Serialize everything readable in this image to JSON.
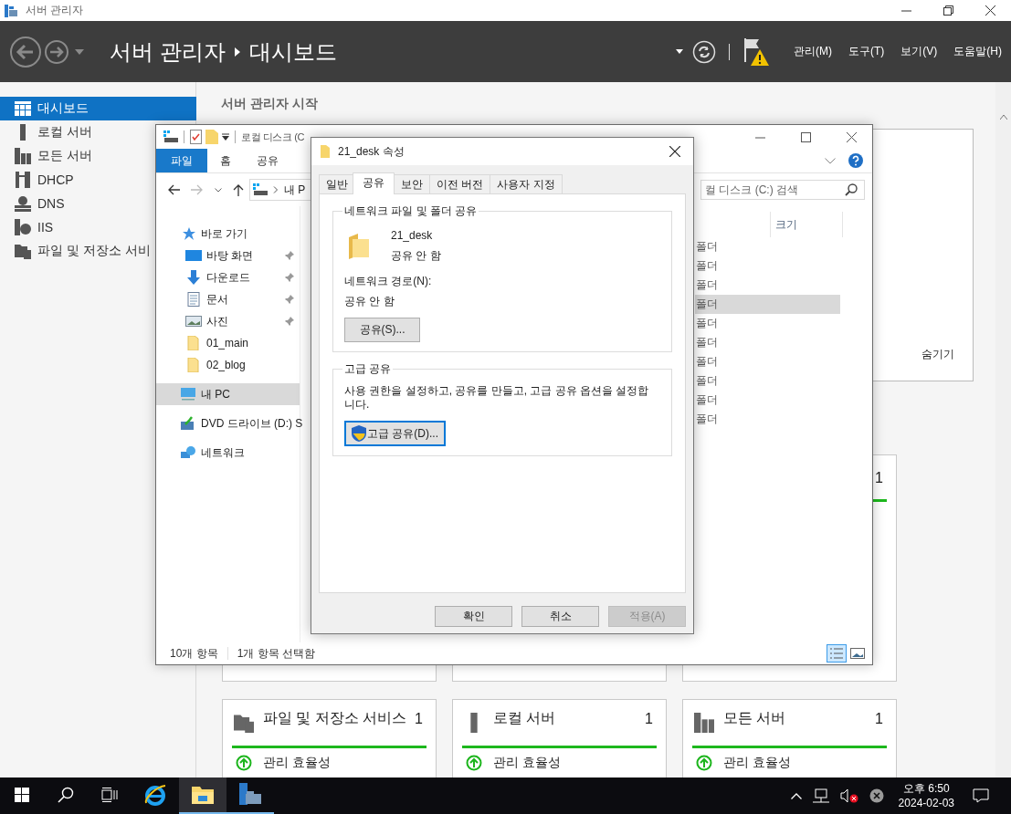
{
  "window": {
    "title": "서버 관리자"
  },
  "header": {
    "breadcrumb": [
      "서버 관리자",
      "대시보드"
    ],
    "menus": [
      "관리(M)",
      "도구(T)",
      "보기(V)",
      "도움말(H)"
    ]
  },
  "sidebar": {
    "items": [
      {
        "kind": "dashboard",
        "label": "대시보드",
        "selected": true
      },
      {
        "kind": "local",
        "label": "로컬 서버",
        "selected": false
      },
      {
        "kind": "all",
        "label": "모든 서버",
        "selected": false
      },
      {
        "kind": "dhcp",
        "label": "DHCP",
        "selected": false
      },
      {
        "kind": "dns",
        "label": "DNS",
        "selected": false
      },
      {
        "kind": "iis",
        "label": "IIS",
        "selected": false
      },
      {
        "kind": "files",
        "label": "파일 및 저장소 서비",
        "selected": false
      }
    ]
  },
  "dashboard": {
    "heading": "서버 관리자 시작",
    "hide": "숨기기",
    "top_row": {
      "count": "1"
    },
    "tiles": [
      {
        "kind": "files",
        "title": "파일 및 저장소 서비스",
        "count": "1",
        "status": "관리 효율성"
      },
      {
        "kind": "local",
        "title": "로컬 서버",
        "count": "1",
        "status": "관리 효율성"
      },
      {
        "kind": "all",
        "title": "모든 서버",
        "count": "1",
        "status": "관리 효율성"
      }
    ]
  },
  "explorer": {
    "title": "로컬 디스크 (C",
    "ribbon_tabs": [
      {
        "label": "파일",
        "selected": true
      },
      {
        "label": "홈",
        "selected": false
      },
      {
        "label": "공유",
        "selected": false
      }
    ],
    "address": "내 P",
    "search": {
      "placeholder": "컬 디스크 (C:) 검색"
    },
    "nav": [
      {
        "kind": "star",
        "label": "바로 가기",
        "selected": false,
        "children": [
          {
            "kind": "desktop",
            "label": "바탕 화면",
            "selected": false,
            "pinned": true
          },
          {
            "kind": "download",
            "label": "다운로드",
            "selected": false,
            "pinned": true
          },
          {
            "kind": "docs",
            "label": "문서",
            "selected": false,
            "pinned": true
          },
          {
            "kind": "pics",
            "label": "사진",
            "selected": false,
            "pinned": true
          },
          {
            "kind": "folder",
            "label": "01_main",
            "selected": false,
            "pinned": false
          },
          {
            "kind": "folder",
            "label": "02_blog",
            "selected": false,
            "pinned": false
          }
        ]
      },
      {
        "kind": "pc",
        "label": "내 PC",
        "selected": true
      },
      {
        "kind": "dvd",
        "label": "DVD 드라이브 (D:) S",
        "selected": false
      },
      {
        "kind": "network",
        "label": "네트워크",
        "selected": false
      }
    ],
    "columns": [
      "크기"
    ],
    "rows": [
      {
        "type": "폴더",
        "selected": false
      },
      {
        "type": "폴더",
        "selected": false
      },
      {
        "type": "폴더",
        "selected": false
      },
      {
        "type": "폴더",
        "selected": true
      },
      {
        "type": "폴더",
        "selected": false
      },
      {
        "type": "폴더",
        "selected": false
      },
      {
        "type": "폴더",
        "selected": false
      },
      {
        "type": "폴더",
        "selected": false
      },
      {
        "type": "폴더",
        "selected": false
      },
      {
        "type": "폴더",
        "selected": false
      }
    ],
    "status": [
      "10개 항목",
      "1개 항목 선택함"
    ]
  },
  "dialog": {
    "title": "21_desk 속성",
    "tabs": [
      {
        "label": "일반",
        "selected": false
      },
      {
        "label": "공유",
        "selected": true
      },
      {
        "label": "보안",
        "selected": false
      },
      {
        "label": "이전 버전",
        "selected": false
      },
      {
        "label": "사용자 지정",
        "selected": false
      }
    ],
    "network_group": {
      "title": "네트워크 파일 및 폴더 공유",
      "name": "21_desk",
      "state": "공유 안 함",
      "path_label": "네트워크 경로(N):",
      "path": "공유 안 함",
      "button": "공유(S)..."
    },
    "advanced_group": {
      "title": "고급 공유",
      "description": "사용 권한을 설정하고, 공유를 만들고, 고급 공유 옵션을 설정합니다.",
      "button": "고급 공유(D)..."
    },
    "buttons": [
      {
        "label": "확인",
        "disabled": false
      },
      {
        "label": "취소",
        "disabled": false
      },
      {
        "label": "적용(A)",
        "disabled": true
      }
    ]
  },
  "taskbar": {
    "apps": [
      {
        "kind": "ie",
        "running": false,
        "active": false
      },
      {
        "kind": "explorer",
        "running": true,
        "active": true
      },
      {
        "kind": "server",
        "running": true,
        "active": false
      }
    ],
    "time": "오후 6:50",
    "date": "2024-02-03"
  }
}
